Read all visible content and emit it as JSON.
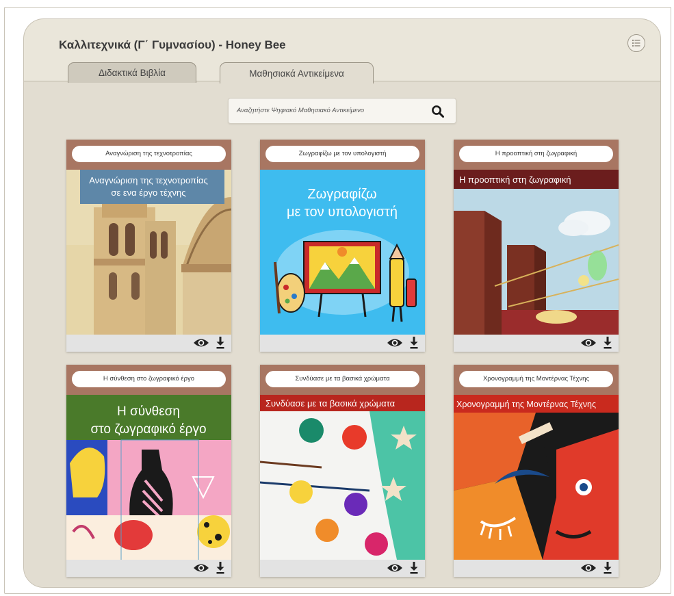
{
  "header": {
    "title": "Καλλιτεχνικά (Γ΄ Γυμνασίου) - Honey Bee",
    "menu_icon": "list-icon"
  },
  "tabs": [
    {
      "label": "Διδακτικά Βιβλία",
      "active": false
    },
    {
      "label": "Μαθησιακά Αντικείμενα",
      "active": true
    }
  ],
  "search": {
    "placeholder": "Αναζητήστε Ψηφιακό Μαθησιακό Αντικείμενο",
    "icon": "search-icon"
  },
  "cards": [
    {
      "label": "Αναγνώριση της τεχνοτροπίας",
      "art_line1": "Αναγνώριση της τεχνοτροπίας",
      "art_line2": "σε ενα έργο τέχνης"
    },
    {
      "label": "Ζωγραφίζω με τον υπολογιστή",
      "art_line1": "Ζωγραφίζω",
      "art_line2": "με τον υπολογιστή"
    },
    {
      "label": "Η προοπτική στη ζωγραφική",
      "art_line1": "Η προοπτική στη ζωγραφική"
    },
    {
      "label": "Η σύνθεση στο ζωγραφικό έργο",
      "art_line1": "Η σύνθεση",
      "art_line2": "στο ζωγραφικό έργο"
    },
    {
      "label": "Συνδύασε με τα βασικά χρώματα",
      "art_line1": "Συνδύασε με τα  βασικά χρώματα"
    },
    {
      "label": "Χρονογραμμή της Μοντέρνας Τέχνης",
      "art_line1": "Χρονογραμμή της Μοντέρνας Τέχνης"
    }
  ],
  "card_actions": {
    "view_icon": "eye-icon",
    "download_icon": "download-icon"
  },
  "colors": {
    "card_header": "#a87662",
    "panel_bg": "#eae6da",
    "content_bg": "#e2ddd1"
  }
}
